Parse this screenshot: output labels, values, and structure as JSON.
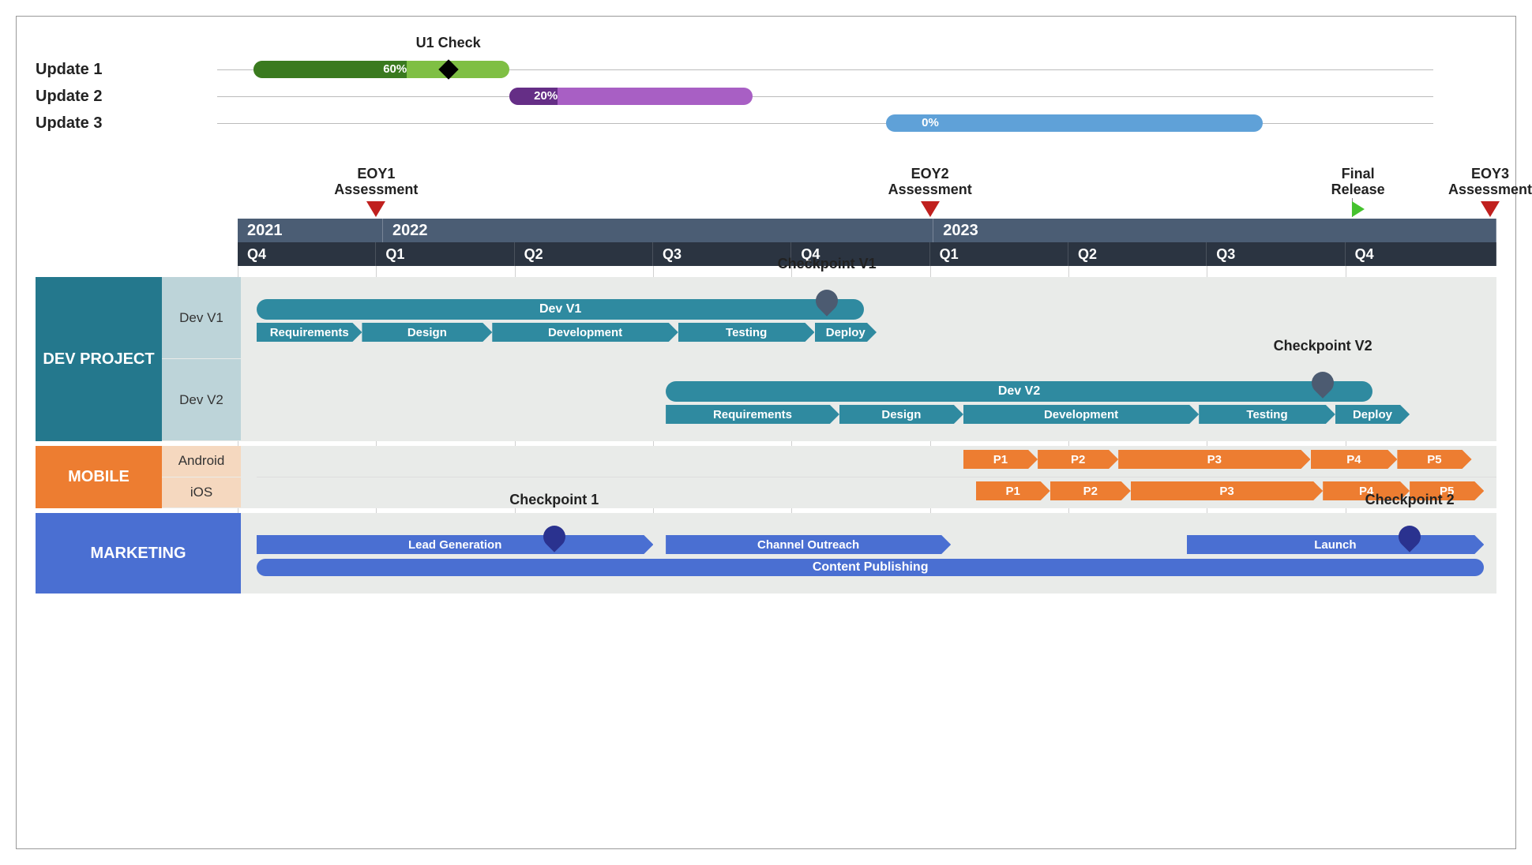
{
  "updates": [
    {
      "label": "Update 1",
      "pct": "60%",
      "pct_val": 60,
      "color_done": "#3a7a1f",
      "color_rest": "#7fbf44",
      "start": 3,
      "end": 24,
      "diamond_at": 19,
      "diamond_label": "U1 Check"
    },
    {
      "label": "Update 2",
      "pct": "20%",
      "pct_val": 20,
      "color_done": "#652e86",
      "color_rest": "#a85fc4",
      "start": 24,
      "end": 44
    },
    {
      "label": "Update 3",
      "pct": "0%",
      "pct_val": 0,
      "color_done": "#2b5b8a",
      "color_rest": "#5fa1d8",
      "start": 55,
      "end": 86
    }
  ],
  "markers": [
    {
      "pos": 11,
      "lines": [
        "EOY1",
        "Assessment"
      ],
      "kind": "red"
    },
    {
      "pos": 55,
      "lines": [
        "EOY2",
        "Assessment"
      ],
      "kind": "red"
    },
    {
      "pos": 89,
      "lines": [
        "Final",
        "Release"
      ],
      "kind": "flag"
    },
    {
      "pos": 99.5,
      "lines": [
        "EOY3",
        "Assessment"
      ],
      "kind": "red"
    }
  ],
  "years": [
    {
      "label": "2021",
      "span": 11
    },
    {
      "label": "2022",
      "span": 44
    },
    {
      "label": "2023",
      "span": 45
    }
  ],
  "quarters": [
    {
      "label": "Q4",
      "span": 11
    },
    {
      "label": "Q1",
      "span": 11
    },
    {
      "label": "Q2",
      "span": 11
    },
    {
      "label": "Q3",
      "span": 11
    },
    {
      "label": "Q4",
      "span": 11
    },
    {
      "label": "Q1",
      "span": 11
    },
    {
      "label": "Q2",
      "span": 11
    },
    {
      "label": "Q3",
      "span": 11
    },
    {
      "label": "Q4",
      "span": 12
    }
  ],
  "lanes": {
    "dev": {
      "title": "DEV PROJECT",
      "head_color": "#25798e",
      "groups": [
        {
          "name": "Dev V1",
          "summary": {
            "start": 0,
            "end": 49,
            "label": "Dev V1",
            "pin_at": 46,
            "pin_label": "Checkpoint V1"
          },
          "tasks": [
            {
              "label": "Requirements",
              "start": 0,
              "end": 8.5
            },
            {
              "label": "Design",
              "start": 8.5,
              "end": 19
            },
            {
              "label": "Development",
              "start": 19,
              "end": 34
            },
            {
              "label": "Testing",
              "start": 34,
              "end": 45
            },
            {
              "label": "Deploy",
              "start": 45,
              "end": 50
            }
          ]
        },
        {
          "name": "Dev V2",
          "summary": {
            "start": 33,
            "end": 90,
            "label": "Dev V2",
            "pin_at": 86,
            "pin_label": "Checkpoint V2"
          },
          "tasks": [
            {
              "label": "Requirements",
              "start": 33,
              "end": 47
            },
            {
              "label": "Design",
              "start": 47,
              "end": 57
            },
            {
              "label": "Development",
              "start": 57,
              "end": 76
            },
            {
              "label": "Testing",
              "start": 76,
              "end": 87
            },
            {
              "label": "Deploy",
              "start": 87,
              "end": 93
            }
          ]
        }
      ]
    },
    "mobile": {
      "title": "MOBILE",
      "head_color": "#ed7d31",
      "rows": [
        {
          "name": "Android",
          "tasks": [
            {
              "label": "P1",
              "start": 57,
              "end": 63
            },
            {
              "label": "P2",
              "start": 63,
              "end": 69.5
            },
            {
              "label": "P3",
              "start": 69.5,
              "end": 85
            },
            {
              "label": "P4",
              "start": 85,
              "end": 92
            },
            {
              "label": "P5",
              "start": 92,
              "end": 98
            }
          ]
        },
        {
          "name": "iOS",
          "tasks": [
            {
              "label": "P1",
              "start": 58,
              "end": 64
            },
            {
              "label": "P2",
              "start": 64,
              "end": 70.5
            },
            {
              "label": "P3",
              "start": 70.5,
              "end": 86
            },
            {
              "label": "P4",
              "start": 86,
              "end": 93
            },
            {
              "label": "P5",
              "start": 93,
              "end": 99
            }
          ]
        }
      ]
    },
    "marketing": {
      "title": "MARKETING",
      "head_color": "#4a6fd2",
      "pins": [
        {
          "at": 24,
          "label": "Checkpoint 1"
        },
        {
          "at": 93,
          "label": "Checkpoint 2"
        }
      ],
      "tasks1": [
        {
          "label": "Lead Generation",
          "start": 0,
          "end": 32
        },
        {
          "label": "Channel Outreach",
          "start": 33,
          "end": 56
        },
        {
          "label": "Launch",
          "start": 75,
          "end": 99
        }
      ],
      "tasks2": [
        {
          "label": "Content Publishing",
          "start": 0,
          "end": 99
        }
      ]
    }
  },
  "chart_data": {
    "type": "gantt",
    "time_axis": {
      "start": "2021-Q4",
      "end": "2023-Q4",
      "units": "quarters"
    },
    "progress_bars": [
      {
        "name": "Update 1",
        "progress_pct": 60,
        "milestones": [
          {
            "name": "U1 Check"
          }
        ]
      },
      {
        "name": "Update 2",
        "progress_pct": 20
      },
      {
        "name": "Update 3",
        "progress_pct": 0
      }
    ],
    "timeline_milestones": [
      {
        "name": "EOY1 Assessment",
        "at": "2022-01",
        "kind": "red-marker"
      },
      {
        "name": "EOY2 Assessment",
        "at": "2023-01",
        "kind": "red-marker"
      },
      {
        "name": "Final Release",
        "at": "2023-Q4",
        "kind": "flag"
      },
      {
        "name": "EOY3 Assessment",
        "at": "2024-01",
        "kind": "red-marker"
      }
    ],
    "swimlanes": [
      {
        "name": "DEV PROJECT",
        "groups": [
          {
            "name": "Dev V1",
            "milestones": [
              "Checkpoint V1"
            ],
            "phases": [
              "Requirements",
              "Design",
              "Development",
              "Testing",
              "Deploy"
            ]
          },
          {
            "name": "Dev V2",
            "milestones": [
              "Checkpoint V2"
            ],
            "phases": [
              "Requirements",
              "Design",
              "Development",
              "Testing",
              "Deploy"
            ]
          }
        ]
      },
      {
        "name": "MOBILE",
        "groups": [
          {
            "name": "Android",
            "phases": [
              "P1",
              "P2",
              "P3",
              "P4",
              "P5"
            ]
          },
          {
            "name": "iOS",
            "phases": [
              "P1",
              "P2",
              "P3",
              "P4",
              "P5"
            ]
          }
        ]
      },
      {
        "name": "MARKETING",
        "milestones": [
          "Checkpoint 1",
          "Checkpoint 2"
        ],
        "tracks": [
          [
            "Lead Generation",
            "Channel Outreach",
            "Launch"
          ],
          [
            "Content Publishing"
          ]
        ]
      }
    ]
  }
}
